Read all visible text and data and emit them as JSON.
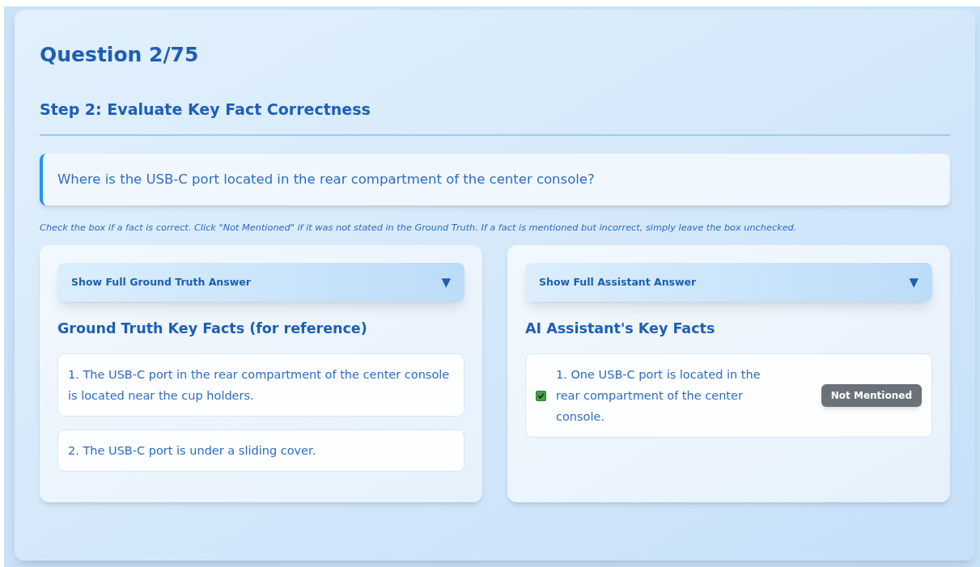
{
  "title": "Question 2/75",
  "step_title": "Step 2: Evaluate Key Fact Correctness",
  "question": "Where is the USB-C port located in the rear compartment of the center console?",
  "instructions": "Check the box if a fact is correct. Click \"Not Mentioned\" if it was not stated in the Ground Truth. If a fact is mentioned but incorrect, simply leave the box unchecked.",
  "panels": [
    {
      "toggle": {
        "label": "Show Full Ground Truth Answer",
        "arrow": "▼",
        "expanded": false
      },
      "heading": "Ground Truth Key Facts (for reference)",
      "facts": [
        {
          "kind": "reference",
          "text": "1. The USB-C port in the rear compartment of the center console is located near the cup holders."
        },
        {
          "kind": "reference",
          "text": "2. The USB-C port is under a sliding cover."
        }
      ]
    },
    {
      "toggle": {
        "label": "Show Full Assistant Answer",
        "arrow": "▼",
        "expanded": false
      },
      "heading": "AI Assistant's Key Facts",
      "facts": [
        {
          "kind": "evaluated",
          "text": "1. One USB-C port is located in the rear compartment of the center console.",
          "checked": true,
          "button": "Not Mentioned"
        }
      ]
    }
  ]
}
